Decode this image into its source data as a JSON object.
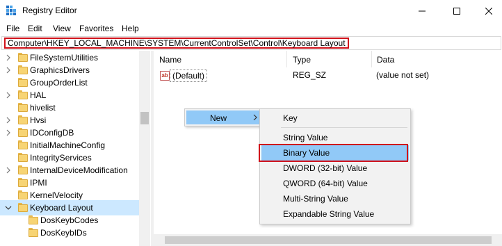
{
  "window": {
    "title": "Registry Editor",
    "controls": [
      "minimize",
      "maximize",
      "close"
    ]
  },
  "menu": [
    "File",
    "Edit",
    "View",
    "Favorites",
    "Help"
  ],
  "address": {
    "path": "Computer\\HKEY_LOCAL_MACHINE\\SYSTEM\\CurrentControlSet\\Control\\Keyboard Layout"
  },
  "tree": {
    "items": [
      {
        "label": "FileSystemUtilities",
        "expandable": true
      },
      {
        "label": "GraphicsDrivers",
        "expandable": true
      },
      {
        "label": "GroupOrderList",
        "expandable": false
      },
      {
        "label": "HAL",
        "expandable": true
      },
      {
        "label": "hivelist",
        "expandable": false
      },
      {
        "label": "Hvsi",
        "expandable": true
      },
      {
        "label": "IDConfigDB",
        "expandable": true
      },
      {
        "label": "InitialMachineConfig",
        "expandable": false
      },
      {
        "label": "IntegrityServices",
        "expandable": false
      },
      {
        "label": "InternalDeviceModification",
        "expandable": true
      },
      {
        "label": "IPMI",
        "expandable": false
      },
      {
        "label": "KernelVelocity",
        "expandable": false
      },
      {
        "label": "Keyboard Layout",
        "expandable": true,
        "expanded": true,
        "selected": true
      }
    ],
    "children": [
      {
        "label": "DosKeybCodes"
      },
      {
        "label": "DosKeybIDs"
      }
    ]
  },
  "list": {
    "columns": {
      "name": "Name",
      "type": "Type",
      "data": "Data"
    },
    "rows": [
      {
        "icon": "ab",
        "name": "(Default)",
        "type": "REG_SZ",
        "data": "(value not set)"
      }
    ]
  },
  "context_menu": {
    "new_label": "New",
    "submenu": [
      "Key",
      "String Value",
      "Binary Value",
      "DWORD (32-bit) Value",
      "QWORD (64-bit) Value",
      "Multi-String Value",
      "Expandable String Value"
    ],
    "highlighted": "Binary Value"
  },
  "colors": {
    "highlight_red": "#d0121b",
    "menu_hover": "#91c9f7",
    "tree_selected": "#cce8ff",
    "folder_yellow": "#f7d474"
  }
}
